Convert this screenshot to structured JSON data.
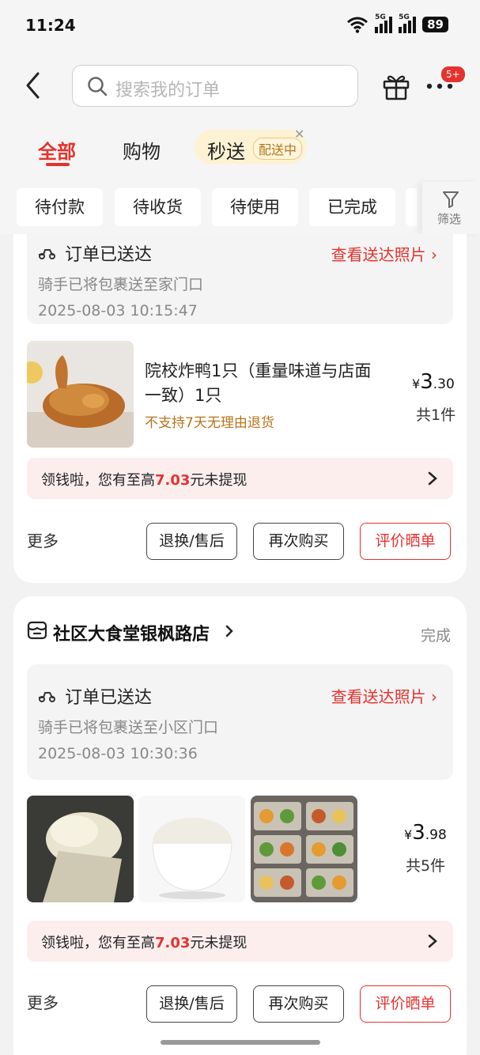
{
  "status_bar": {
    "time": "11:24",
    "sig1_label": "5G",
    "sig2_label": "5G",
    "battery": "89"
  },
  "header": {
    "search_placeholder": "搜索我的订单",
    "more_badge": "5+"
  },
  "tabs": [
    {
      "label": "全部",
      "active": true
    },
    {
      "label": "购物"
    },
    {
      "label": "秒送",
      "pill": "配送中"
    }
  ],
  "filters": [
    "待付款",
    "待收货",
    "待使用",
    "已完成"
  ],
  "filter_button": "筛选",
  "orders": [
    {
      "delivery": {
        "title": "订单已送达",
        "link": "查看送达照片",
        "desc": "骑手已将包裹送至家门口",
        "time": "2025-08-03 10:15:47"
      },
      "product_name": "院校炸鸭1只（重量味道与店面一致）1只",
      "product_note": "不支持7天无理由退货",
      "price_currency": "¥",
      "price_int": "3",
      "price_dec": ".30",
      "quantity": "共1件",
      "cash_prefix": "领钱啦，您有至高",
      "cash_amount": "7.03",
      "cash_suffix": "元未提现",
      "more": "更多",
      "buttons": [
        "退换/售后",
        "再次购买",
        "评价晒单"
      ]
    },
    {
      "shop_name": "社区大食堂银枫路店",
      "status": "完成",
      "delivery": {
        "title": "订单已送达",
        "link": "查看送达照片",
        "desc": "骑手已将包裹送至小区门口",
        "time": "2025-08-03 10:30:36"
      },
      "price_currency": "¥",
      "price_int": "3",
      "price_dec": ".98",
      "quantity": "共5件",
      "cash_prefix": "领钱啦，您有至高",
      "cash_amount": "7.03",
      "cash_suffix": "元未提现",
      "more": "更多",
      "buttons": [
        "退换/售后",
        "再次购买",
        "评价晒单"
      ]
    }
  ],
  "colors": {
    "accent": "#e5322d",
    "page_bg": "#f2f2f2",
    "note_brown": "#b8741b"
  }
}
